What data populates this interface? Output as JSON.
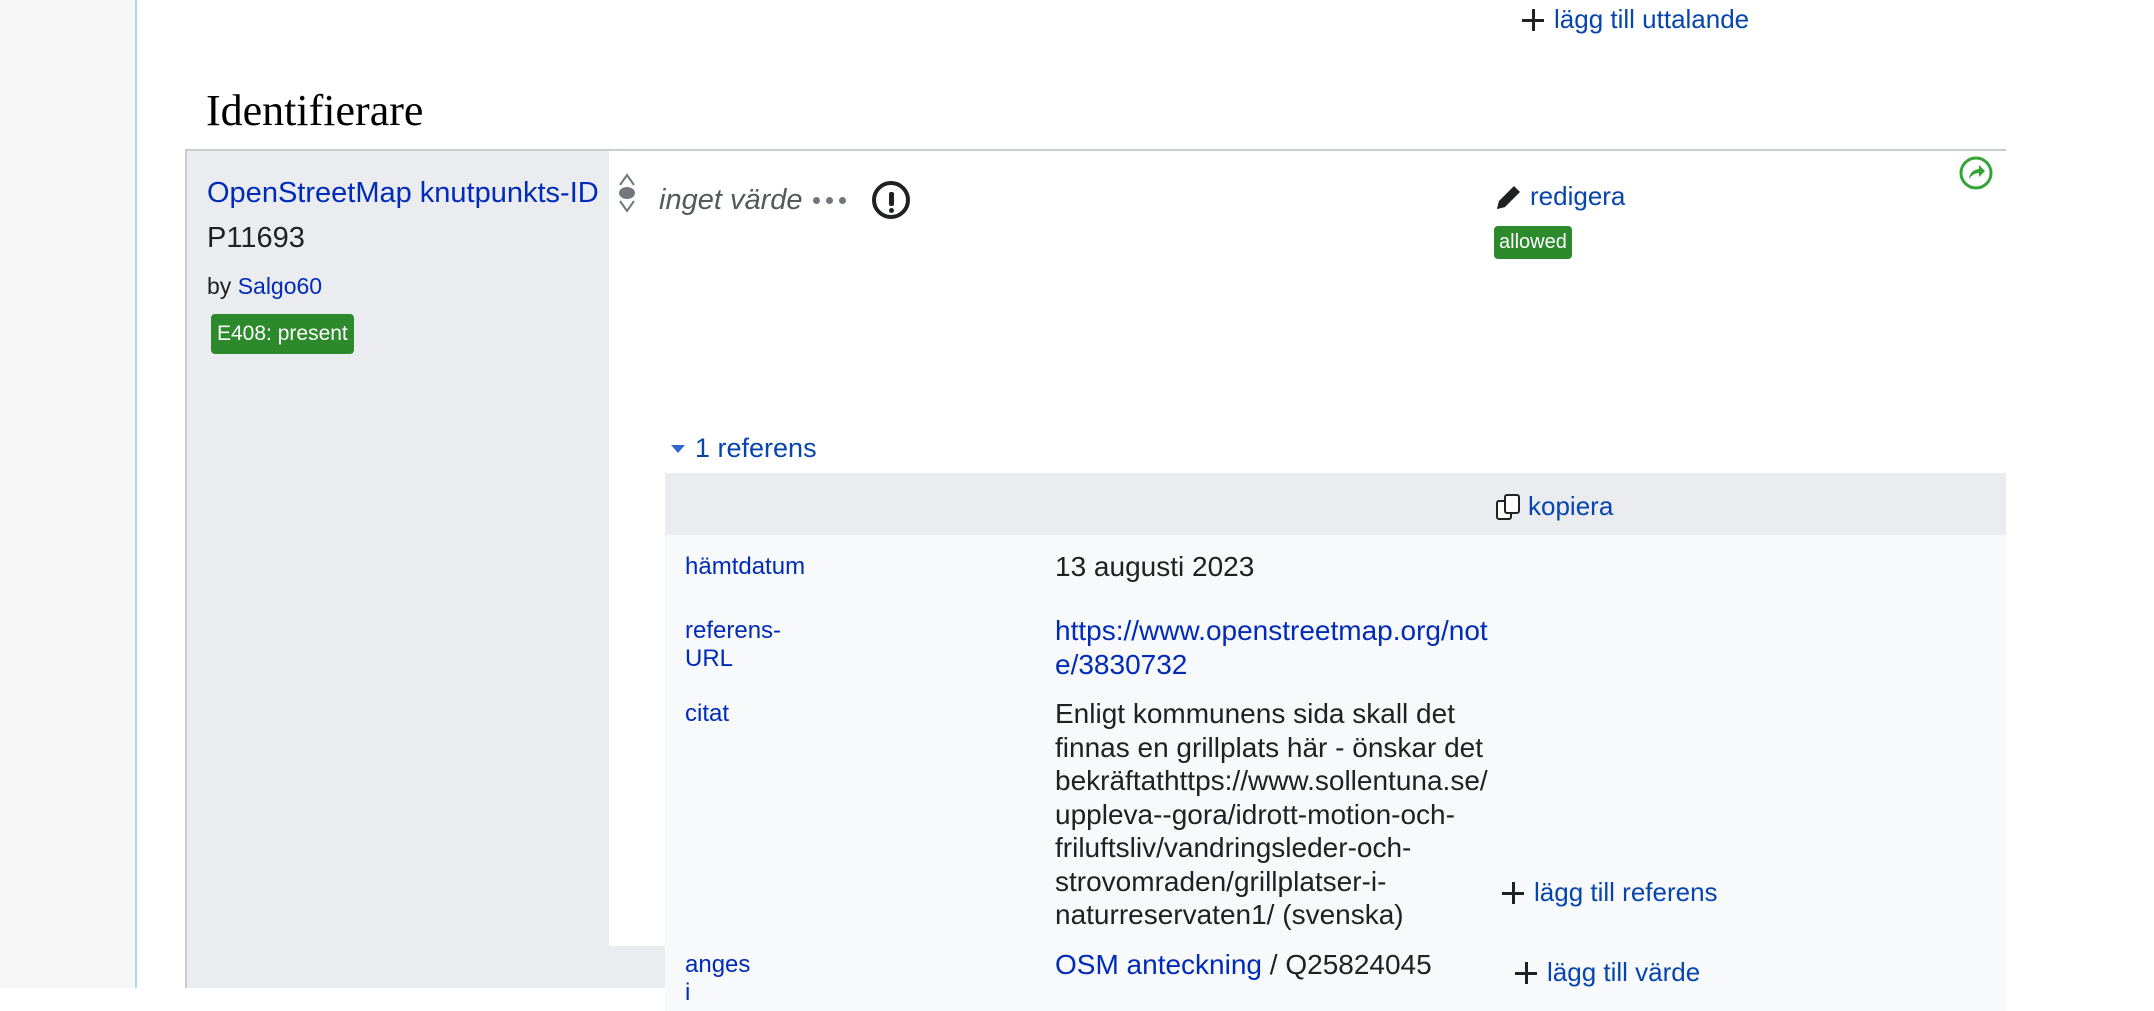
{
  "top_link": {
    "add_pronunciation": "lägg till uttalande"
  },
  "section": {
    "heading": "Identifierare"
  },
  "property": {
    "label": "OpenStreetMap knutpunkts-ID",
    "id": "P11693",
    "by_prefix": "by",
    "by_user": "Salgo60",
    "constraint_badge": "E408: present"
  },
  "statement": {
    "value": "inget värde",
    "edit_label": "redigera",
    "status_badge": "allowed",
    "references_toggle": "1 referens",
    "copy_label": "kopiera",
    "snaks": [
      {
        "property": "hämtdatum",
        "value": "13 augusti 2023"
      },
      {
        "property": "referens-URL",
        "value_line1": "https://www.openstreetmap.org/not",
        "value_line2": "e/3830732"
      },
      {
        "property": "citat",
        "lines": [
          "Enligt kommunens sida skall det",
          "finnas en grillplats här - önskar det",
          "bekräftathttps://www.sollentuna.se/",
          "uppleva--gora/idrott-motion-och-",
          "friluftsliv/vandringsleder-och-",
          "strovomraden/grillplatser-i-",
          "naturreservaten1/ (svenska)"
        ]
      },
      {
        "property": "anges i",
        "value_link": "OSM anteckning",
        "value_sep": " / ",
        "value_id": "Q25824045"
      }
    ],
    "add_reference": "lägg till referens"
  },
  "add_value": "lägg till värde",
  "colors": {
    "link": "#0645ad",
    "badge_green": "#2c8a2c",
    "group_bg": "#eaecf0"
  }
}
